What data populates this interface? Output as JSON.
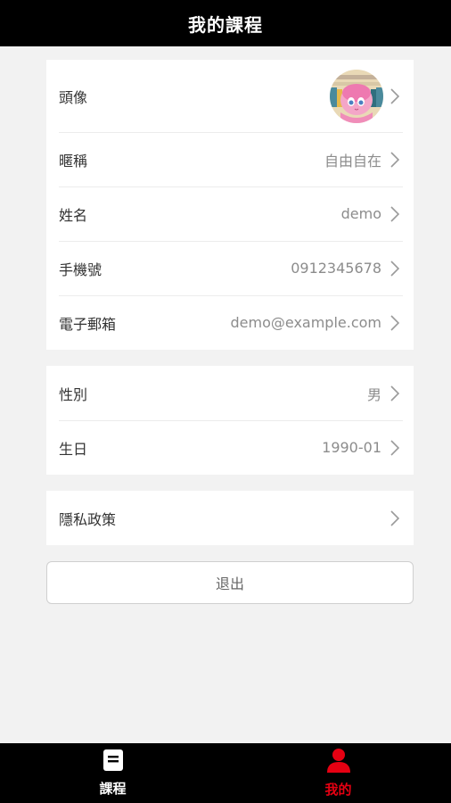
{
  "header": {
    "title": "我的課程"
  },
  "profile": {
    "items": [
      {
        "label": "頭像"
      },
      {
        "label": "暱稱",
        "value": "自由自在"
      },
      {
        "label": "姓名",
        "value": "demo"
      },
      {
        "label": "手機號",
        "value": "0912345678"
      },
      {
        "label": "電子郵箱",
        "value": "demo@example.com"
      }
    ]
  },
  "personal": {
    "items": [
      {
        "label": "性別",
        "value": "男"
      },
      {
        "label": "生日",
        "value": "1990-01"
      }
    ]
  },
  "privacy": {
    "label": "隱私政策"
  },
  "logout": {
    "label": "退出"
  },
  "tabbar": {
    "tabs": [
      {
        "label": "課程",
        "icon": "book-icon",
        "active": false,
        "color": "#ffffff"
      },
      {
        "label": "我的",
        "icon": "user-icon",
        "active": true,
        "color": "#e60012"
      }
    ]
  },
  "colors": {
    "accent": "#e60012",
    "header_bg": "#000000",
    "page_bg": "#f2f2f2"
  }
}
